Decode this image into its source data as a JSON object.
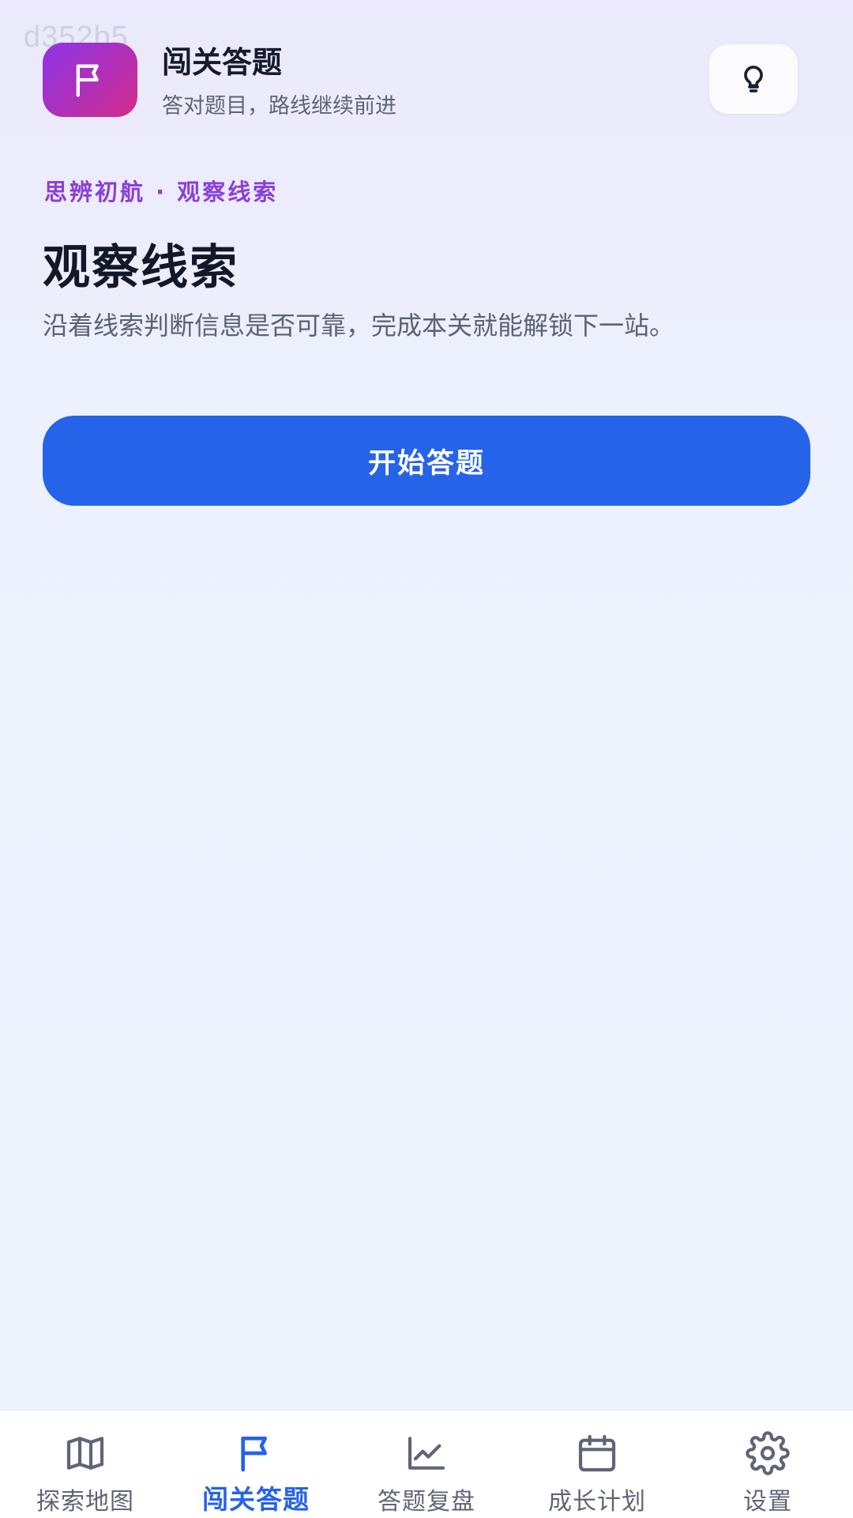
{
  "watermark": "d352b5",
  "header": {
    "title": "闯关答题",
    "subtitle": "答对题目，路线继续前进",
    "logo_icon": "flag-icon",
    "tip_icon": "lightbulb-icon"
  },
  "main": {
    "breadcrumb": "思辨初航 · 观察线索",
    "title": "观察线索",
    "description": "沿着线索判断信息是否可靠，完成本关就能解锁下一站。",
    "start_button_label": "开始答题"
  },
  "bottom_nav": {
    "active_index": 1,
    "items": [
      {
        "label": "探索地图",
        "icon": "map-icon"
      },
      {
        "label": "闯关答题",
        "icon": "flag-icon"
      },
      {
        "label": "答题复盘",
        "icon": "chart-line-icon"
      },
      {
        "label": "成长计划",
        "icon": "calendar-icon"
      },
      {
        "label": "设置",
        "icon": "gear-icon"
      }
    ]
  },
  "colors": {
    "accent": "#2563e8",
    "brand_purple": "#8b3fd8",
    "logo_gradient_start": "#8c35e6",
    "logo_gradient_end": "#d42c88"
  }
}
